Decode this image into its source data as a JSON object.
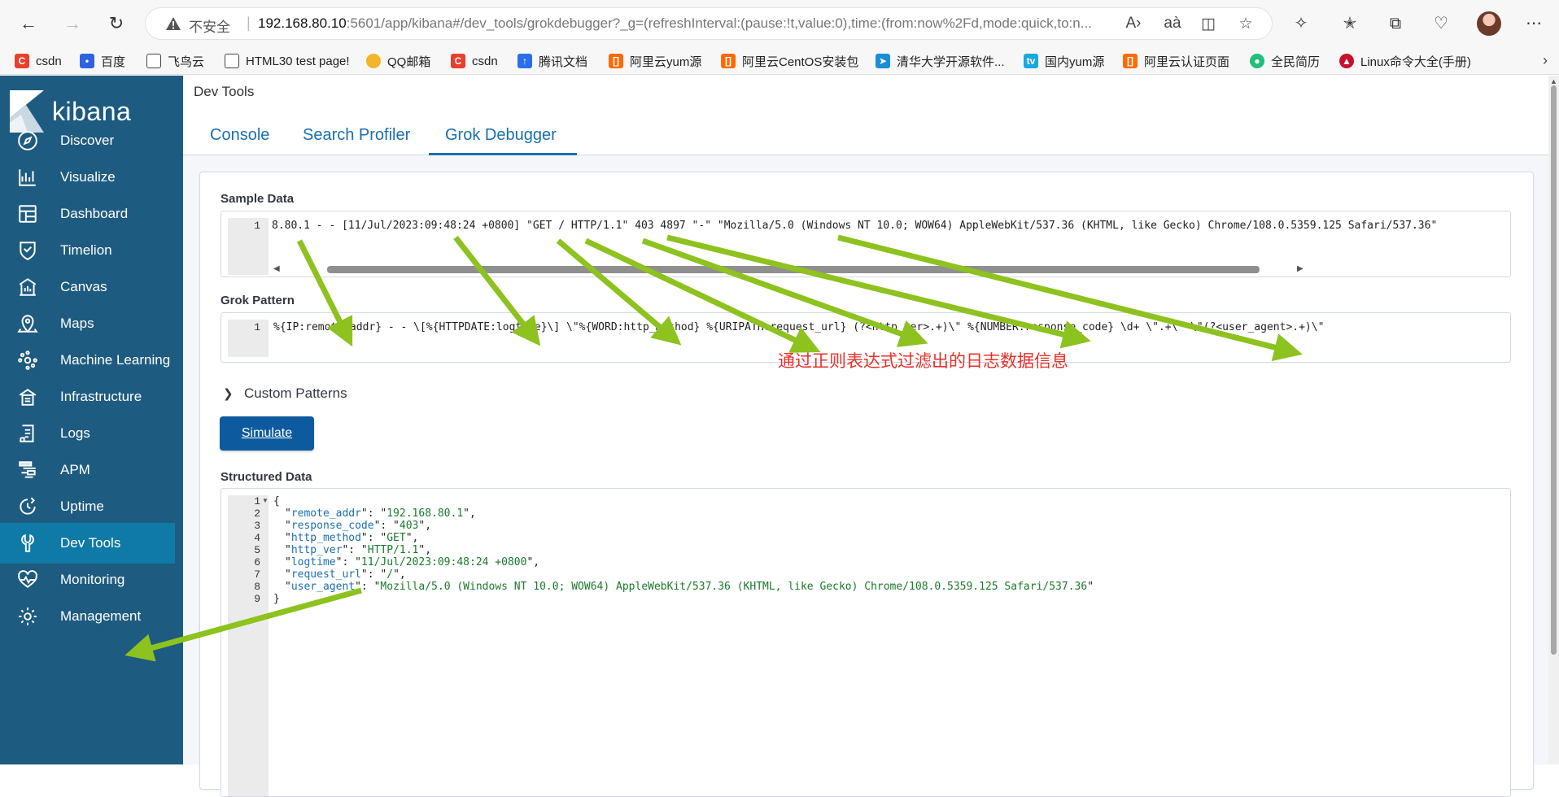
{
  "browser": {
    "insecure_label": "不安全",
    "url_host": "192.168.80.10",
    "url_path": ":5601/app/kibana#/dev_tools/grokdebugger?_g=(refreshInterval:(pause:!t,value:0),time:(from:now%2Fd,mode:quick,to:n...",
    "bookmarks": [
      {
        "label": "csdn",
        "icon": "csdn-icon",
        "color": "#e8402d"
      },
      {
        "label": "百度",
        "icon": "baidu-icon",
        "color": "#2f62e0"
      },
      {
        "label": "飞鸟云",
        "icon": "page-icon",
        "color": "#ffffff"
      },
      {
        "label": "HTML30 test page!",
        "icon": "page-icon",
        "color": "#ffffff"
      },
      {
        "label": "QQ邮箱",
        "icon": "qqmail-icon",
        "color": "#f2b52c"
      },
      {
        "label": "csdn",
        "icon": "csdn-icon",
        "color": "#e8402d"
      },
      {
        "label": "腾讯文档",
        "icon": "tencent-docs-icon",
        "color": "#2a6ee8"
      },
      {
        "label": "阿里云yum源",
        "icon": "aliyun-icon",
        "color": "#ff6a00"
      },
      {
        "label": "阿里云CentOS安装包",
        "icon": "aliyun-icon",
        "color": "#ff6a00"
      },
      {
        "label": "清华大学开源软件...",
        "icon": "tsinghua-icon",
        "color": "#1a8ed6"
      },
      {
        "label": "国内yum源",
        "icon": "bilibili-icon",
        "color": "#1aa8e0"
      },
      {
        "label": "阿里云认证页面",
        "icon": "aliyun-icon",
        "color": "#ff6a00"
      },
      {
        "label": "全民简历",
        "icon": "resume-icon",
        "color": "#20c07a"
      },
      {
        "label": "Linux命令大全(手册)",
        "icon": "redhat-icon",
        "color": "#c8102e"
      }
    ]
  },
  "sidebar": {
    "logo_text": "kibana",
    "items": [
      {
        "label": "Discover",
        "icon": "compass-icon"
      },
      {
        "label": "Visualize",
        "icon": "chart-icon"
      },
      {
        "label": "Dashboard",
        "icon": "dashboard-icon"
      },
      {
        "label": "Timelion",
        "icon": "shield-icon"
      },
      {
        "label": "Canvas",
        "icon": "canvas-icon"
      },
      {
        "label": "Maps",
        "icon": "map-pin-icon"
      },
      {
        "label": "Machine Learning",
        "icon": "ml-icon"
      },
      {
        "label": "Infrastructure",
        "icon": "infrastructure-icon"
      },
      {
        "label": "Logs",
        "icon": "logs-icon"
      },
      {
        "label": "APM",
        "icon": "apm-icon"
      },
      {
        "label": "Uptime",
        "icon": "uptime-icon"
      },
      {
        "label": "Dev Tools",
        "icon": "wrench-icon",
        "active": true
      },
      {
        "label": "Monitoring",
        "icon": "heartbeat-icon"
      },
      {
        "label": "Management",
        "icon": "gear-icon"
      }
    ]
  },
  "header": {
    "title": "Dev Tools",
    "tabs": [
      {
        "label": "Console"
      },
      {
        "label": "Search Profiler"
      },
      {
        "label": "Grok Debugger",
        "active": true
      }
    ]
  },
  "sample_data": {
    "label": "Sample Data",
    "line_number": "1",
    "text": "8.80.1 - - [11/Jul/2023:09:48:24 +0800] \"GET / HTTP/1.1\" 403 4897 \"-\" \"Mozilla/5.0 (Windows NT 10.0; WOW64) AppleWebKit/537.36 (KHTML, like Gecko) Chrome/108.0.5359.125 Safari/537.36\""
  },
  "grok_pattern": {
    "label": "Grok Pattern",
    "line_number": "1",
    "text": "%{IP:remote_addr} - - \\[%{HTTPDATE:logtime}\\] \\\"%{WORD:http_method} %{URIPATH:request_url} (?<http_ver>.+)\\\" %{NUMBER:response_code} \\d+ \\\".+\\\" \\\"(?<user_agent>.+)\\\""
  },
  "annotation": "通过正则表达式过滤出的日志数据信息",
  "custom_patterns": {
    "label": "Custom Patterns"
  },
  "simulate": {
    "label": "Simulate"
  },
  "structured_data": {
    "label": "Structured Data",
    "open_brace": "{",
    "close_brace": "}",
    "line_numbers": [
      "1",
      "2",
      "3",
      "4",
      "5",
      "6",
      "7",
      "8",
      "9"
    ],
    "fields": [
      {
        "key": "remote_addr",
        "value": "192.168.80.1"
      },
      {
        "key": "response_code",
        "value": "403"
      },
      {
        "key": "http_method",
        "value": "GET"
      },
      {
        "key": "http_ver",
        "value": "HTTP/1.1"
      },
      {
        "key": "logtime",
        "value": "11/Jul/2023:09:48:24 +0800"
      },
      {
        "key": "request_url",
        "value": "/"
      },
      {
        "key": "user_agent",
        "value": "Mozilla/5.0 (Windows NT 10.0; WOW64) AppleWebKit/537.36 (KHTML, like Gecko) Chrome/108.0.5359.125 Safari/537.36"
      }
    ]
  },
  "colors": {
    "sidebar_bg": "#1e5b80",
    "sidebar_active": "#0f7aa5",
    "link_blue": "#1a6fb0",
    "button_blue": "#0e5a9e",
    "arrow_green": "#8dc21f",
    "annotation_red": "#e8302a"
  }
}
